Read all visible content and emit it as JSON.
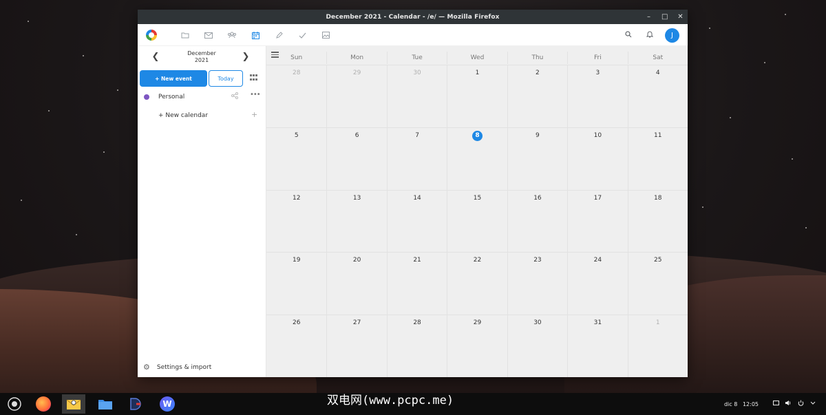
{
  "window": {
    "title": "December 2021 - Calendar - /e/ — Mozilla Firefox",
    "controls": [
      "minimize-icon",
      "maximize-icon",
      "close-icon"
    ]
  },
  "topbar": {
    "logo": "e-logo",
    "app_icons": [
      "folder-icon",
      "mail-icon",
      "contacts-icon",
      "calendar-icon",
      "notes-icon",
      "tasks-icon",
      "photos-icon"
    ],
    "active_app": "calendar-icon",
    "right_icons": [
      "search-icon",
      "bell-icon"
    ],
    "avatar_letter": "J"
  },
  "sidebar": {
    "month": "December",
    "year": "2021",
    "new_event_label": "+ New event",
    "today_label": "Today",
    "calendars": [
      {
        "name": "Personal",
        "color": "#7e57c2"
      }
    ],
    "new_calendar_label": "+ New calendar",
    "new_calendar_plus": "+",
    "settings_label": "Settings & import"
  },
  "calendar": {
    "weekdays": [
      "Sun",
      "Mon",
      "Tue",
      "Wed",
      "Thu",
      "Fri",
      "Sat"
    ],
    "weeks": [
      [
        {
          "d": "28",
          "out": true
        },
        {
          "d": "29",
          "out": true
        },
        {
          "d": "30",
          "out": true
        },
        {
          "d": "1"
        },
        {
          "d": "2"
        },
        {
          "d": "3"
        },
        {
          "d": "4"
        }
      ],
      [
        {
          "d": "5"
        },
        {
          "d": "6"
        },
        {
          "d": "7"
        },
        {
          "d": "8",
          "today": true
        },
        {
          "d": "9"
        },
        {
          "d": "10"
        },
        {
          "d": "11"
        }
      ],
      [
        {
          "d": "12"
        },
        {
          "d": "13"
        },
        {
          "d": "14"
        },
        {
          "d": "15"
        },
        {
          "d": "16"
        },
        {
          "d": "17"
        },
        {
          "d": "18"
        }
      ],
      [
        {
          "d": "19"
        },
        {
          "d": "20"
        },
        {
          "d": "21"
        },
        {
          "d": "22"
        },
        {
          "d": "23"
        },
        {
          "d": "24"
        },
        {
          "d": "25"
        }
      ],
      [
        {
          "d": "26"
        },
        {
          "d": "27"
        },
        {
          "d": "28"
        },
        {
          "d": "29"
        },
        {
          "d": "30"
        },
        {
          "d": "31"
        },
        {
          "d": "1",
          "out": true
        }
      ]
    ],
    "accent_color": "#1e88e5"
  },
  "taskbar": {
    "apps": [
      "launcher-icon",
      "firefox-icon",
      "mail-app-icon",
      "files-icon",
      "media-player-icon",
      "writer-icon"
    ],
    "active_app": "mail-app-icon",
    "watermark": "双电网(www.pcpc.me)",
    "date": "dic 8",
    "time": "12:05",
    "tray_icons": [
      "screen-icon",
      "volume-icon",
      "power-icon",
      "chevron-down-icon"
    ]
  }
}
